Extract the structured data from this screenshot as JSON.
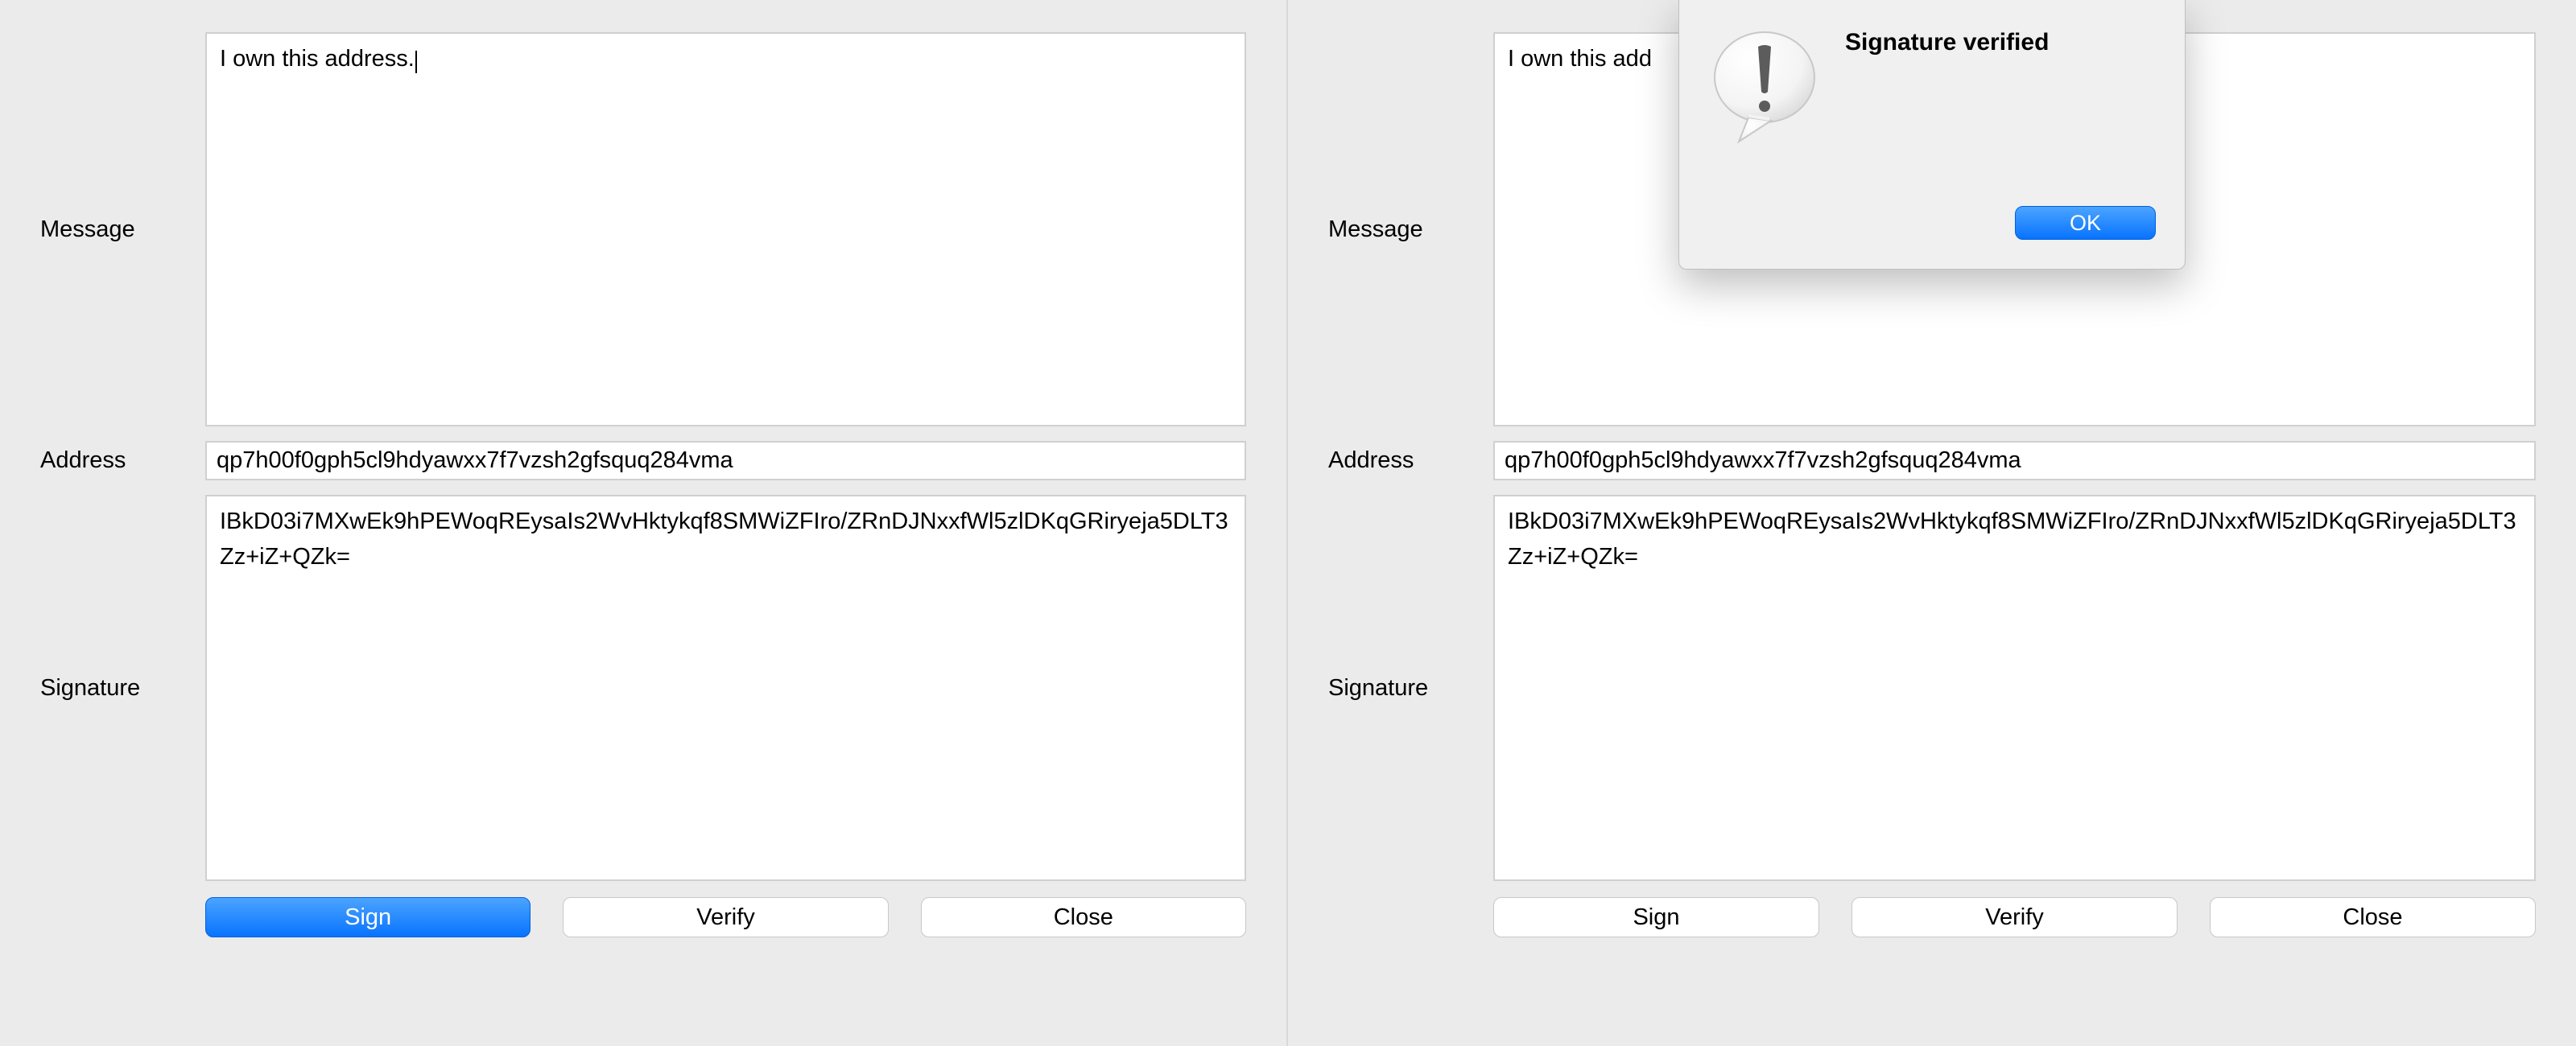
{
  "left": {
    "message_label": "Message",
    "address_label": "Address",
    "signature_label": "Signature",
    "message_value": "I own this address.",
    "address_value": "qp7h00f0gph5cl9hdyawxx7f7vzsh2gfsquq284vma",
    "signature_value": "IBkD03i7MXwEk9hPEWoqREysaIs2WvHktykqf8SMWiZFIro/ZRnDJNxxfWl5zlDKqGRiryeja5DLT3Zz+iZ+QZk=",
    "buttons": {
      "sign": "Sign",
      "verify": "Verify",
      "close": "Close"
    }
  },
  "right": {
    "message_label": "Message",
    "address_label": "Address",
    "signature_label": "Signature",
    "message_value": "I own this add",
    "address_value": "qp7h00f0gph5cl9hdyawxx7f7vzsh2gfsquq284vma",
    "signature_value": "IBkD03i7MXwEk9hPEWoqREysaIs2WvHktykqf8SMWiZFIro/ZRnDJNxxfWl5zlDKqGRiryeja5DLT3Zz+iZ+QZk=",
    "buttons": {
      "sign": "Sign",
      "verify": "Verify",
      "close": "Close"
    },
    "alert": {
      "title": "Signature verified",
      "ok": "OK"
    }
  }
}
